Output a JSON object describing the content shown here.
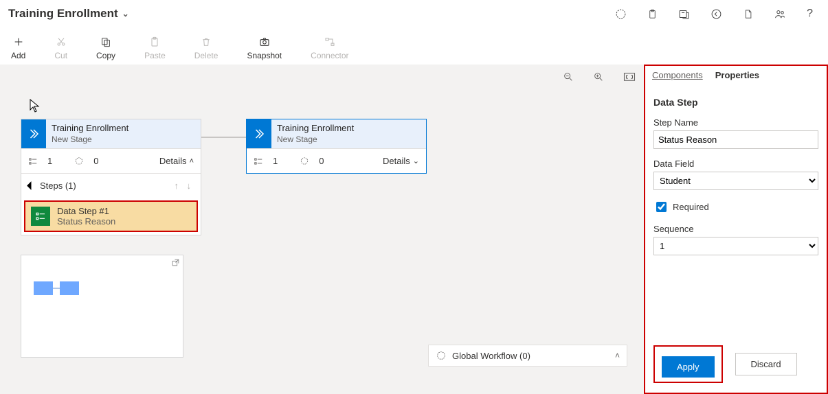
{
  "header": {
    "title": "Training Enrollment"
  },
  "toolbar": {
    "add": "Add",
    "cut": "Cut",
    "copy": "Copy",
    "paste": "Paste",
    "delete": "Delete",
    "snapshot": "Snapshot",
    "connector": "Connector"
  },
  "stage1": {
    "line1": "Training Enrollment",
    "line2": "New Stage",
    "step_count": "1",
    "wf_count": "0",
    "details": "Details",
    "steps_header": "Steps (1)"
  },
  "stage2": {
    "line1": "Training Enrollment",
    "line2": "New Stage",
    "step_count": "1",
    "wf_count": "0",
    "details": "Details"
  },
  "data_step": {
    "title": "Data Step #1",
    "subtitle": "Status Reason"
  },
  "global_workflow": {
    "label": "Global Workflow (0)"
  },
  "panel": {
    "tabs": {
      "components": "Components",
      "properties": "Properties"
    },
    "section": "Data Step",
    "step_name_label": "Step Name",
    "step_name_value": "Status Reason",
    "data_field_label": "Data Field",
    "data_field_value": "Student",
    "required_label": "Required",
    "sequence_label": "Sequence",
    "sequence_value": "1",
    "apply": "Apply",
    "discard": "Discard"
  }
}
